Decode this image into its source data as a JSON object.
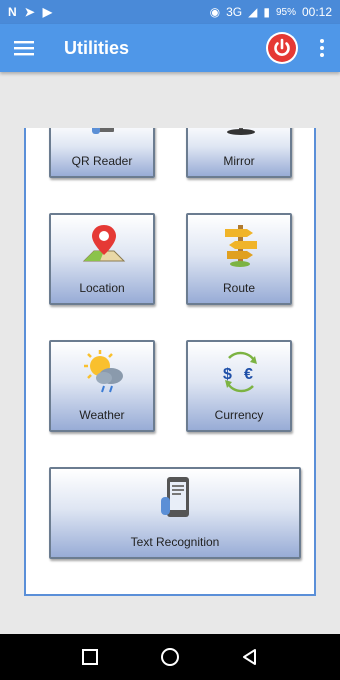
{
  "status": {
    "battery": "95%",
    "time": "00:12",
    "network": "3G"
  },
  "app_bar": {
    "title": "Utilities"
  },
  "tiles": [
    {
      "label": "QR Reader"
    },
    {
      "label": "Mirror"
    },
    {
      "label": "Location"
    },
    {
      "label": "Route"
    },
    {
      "label": "Weather"
    },
    {
      "label": "Currency"
    },
    {
      "label": "Text Recognition"
    }
  ],
  "colors": {
    "app_bar": "#4f97e8",
    "power": "#e53935",
    "tile_bottom": "#98acd6"
  }
}
